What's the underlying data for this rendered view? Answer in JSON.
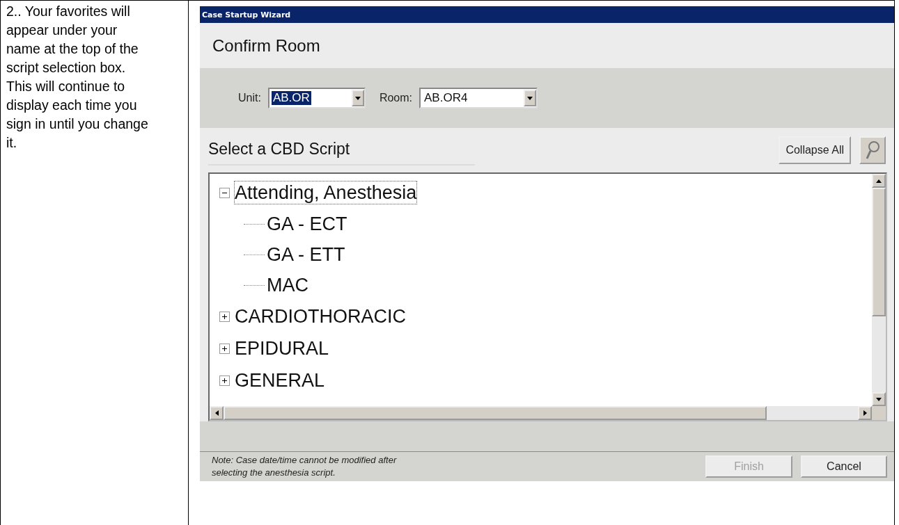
{
  "instruction": {
    "text": "2..  Your favorites will appear under your name at the top of the script selection box.  This will continue to display each time you sign in until you change it."
  },
  "window": {
    "title": "Case Startup Wizard"
  },
  "header": {
    "title": "Confirm Room"
  },
  "fields": [
    {
      "label": "Unit:",
      "value": "AB.OR",
      "highlighted": true
    },
    {
      "label": "Room:",
      "value": "AB.OR4",
      "highlighted": false
    }
  ],
  "script_section": {
    "title": "Select a CBD Script",
    "collapse_button": "Collapse All"
  },
  "tree": [
    {
      "label": "Attending, Anesthesia",
      "expanded": true,
      "focused": true,
      "children": [
        {
          "label": "GA - ECT"
        },
        {
          "label": "GA - ETT"
        },
        {
          "label": "MAC"
        }
      ]
    },
    {
      "label": "CARDIOTHORACIC",
      "expanded": false,
      "focused": false
    },
    {
      "label": "EPIDURAL",
      "expanded": false,
      "focused": false
    },
    {
      "label": "GENERAL",
      "expanded": false,
      "focused": false
    }
  ],
  "note": "Note:  Case date/time cannot be modified after selecting the anesthesia script.",
  "buttons": [
    {
      "label": "Finish",
      "disabled": true
    },
    {
      "label": "Cancel",
      "disabled": false
    }
  ]
}
